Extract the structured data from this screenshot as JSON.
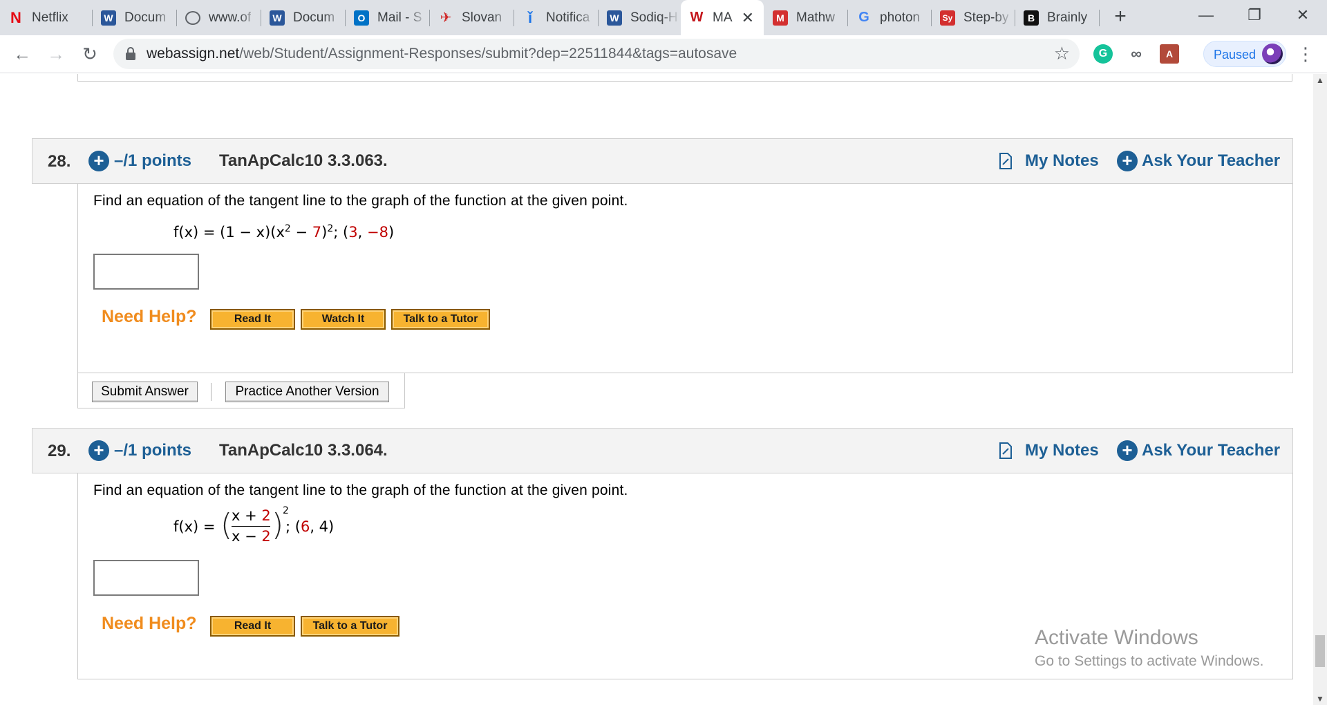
{
  "browser": {
    "tabs": [
      {
        "label": "Netflix",
        "icon": "netflix-icon"
      },
      {
        "label": "Docum",
        "icon": "word-icon"
      },
      {
        "label": "www.of",
        "icon": "globe-icon"
      },
      {
        "label": "Docum",
        "icon": "word-icon"
      },
      {
        "label": "Mail - S",
        "icon": "outlook-icon"
      },
      {
        "label": "Slovan",
        "icon": "slovan-icon"
      },
      {
        "label": "Notifica",
        "icon": "info-icon"
      },
      {
        "label": "Sodiq-H",
        "icon": "word-icon"
      },
      {
        "label": "MA",
        "icon": "webassign-icon",
        "active": true
      },
      {
        "label": "Mathw",
        "icon": "mathway-icon"
      },
      {
        "label": "photon",
        "icon": "google-icon"
      },
      {
        "label": "Step-by",
        "icon": "symbolab-icon"
      },
      {
        "label": "Brainly",
        "icon": "brainly-icon"
      }
    ],
    "url_host": "webassign.net",
    "url_path": "/web/Student/Assignment-Responses/submit?dep=22511844&tags=autosave",
    "profile_status": "Paused"
  },
  "questions": [
    {
      "number": "28.",
      "points": "–/1 points",
      "code": "TanApCalc10 3.3.063.",
      "my_notes": "My Notes",
      "ask_teacher": "Ask Your Teacher",
      "prompt": "Find an equation of the tangent line to the graph of the function at the given point.",
      "need_help": "Need Help?",
      "help_buttons": [
        "Read It",
        "Watch It",
        "Talk to a Tutor"
      ]
    },
    {
      "number": "29.",
      "points": "–/1 points",
      "code": "TanApCalc10 3.3.064.",
      "my_notes": "My Notes",
      "ask_teacher": "Ask Your Teacher",
      "prompt": "Find an equation of the tangent line to the graph of the function at the given point.",
      "need_help": "Need Help?",
      "help_buttons": [
        "Read It",
        "Talk to a Tutor"
      ]
    }
  ],
  "q28_formula": {
    "lhs": "f(x) = (1 − x)(x",
    "sq1": "2",
    "minus": " − ",
    "seven": "7",
    "close": ")",
    "sq2": "2",
    "sep": "; (",
    "px": "3",
    "comma": ", ",
    "py": "−8",
    "end": ")"
  },
  "q29_formula": {
    "lhs": "f(x) =",
    "num_x": "x + ",
    "num_c": "2",
    "den_x": "x − ",
    "den_c": "2",
    "exp": "2",
    "sep": "; (",
    "px": "6",
    "comma": ", 4)"
  },
  "submit": {
    "submit_label": "Submit Answer",
    "practice_label": "Practice Another Version"
  },
  "watermark": {
    "line1": "Activate Windows",
    "line2": "Go to Settings to activate Windows."
  }
}
